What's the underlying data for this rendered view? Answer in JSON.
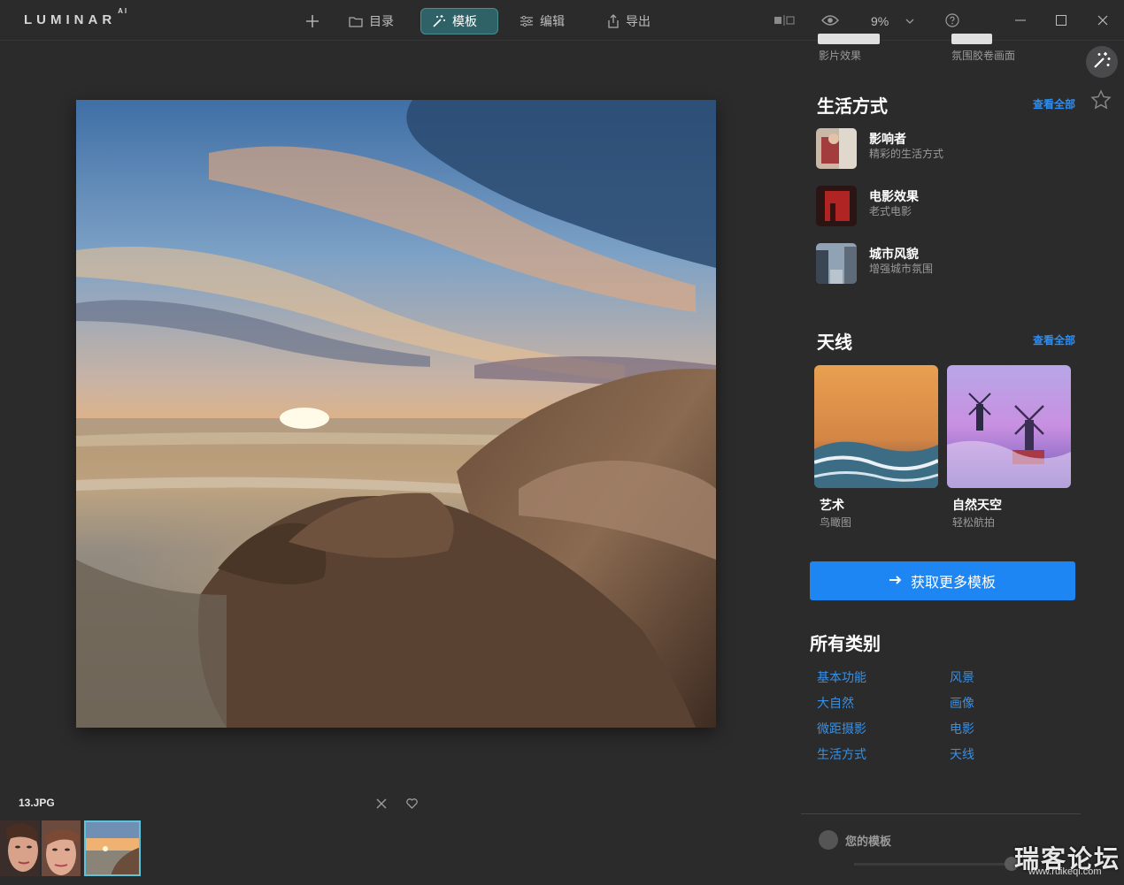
{
  "app": {
    "logo": "LUMINAR",
    "logo_suffix": "AI"
  },
  "toolbar": {
    "catalog_label": "目录",
    "templates_label": "模板",
    "edit_label": "编辑",
    "export_label": "导出",
    "zoom": "9%"
  },
  "filmstrip": {
    "filename": "13.JPG"
  },
  "panel": {
    "cutoff": {
      "left_sub": "影片效果",
      "right_sub": "氛围胶卷画面"
    },
    "lifestyle": {
      "title": "生活方式",
      "see_all": "查看全部",
      "items": [
        {
          "title": "影响者",
          "sub": "精彩的生活方式"
        },
        {
          "title": "电影效果",
          "sub": "老式电影"
        },
        {
          "title": "城市风貌",
          "sub": "增强城市氛围"
        }
      ]
    },
    "sky": {
      "title": "天线",
      "see_all": "查看全部",
      "cards": [
        {
          "title": "艺术",
          "sub": "鸟瞰图"
        },
        {
          "title": "自然天空",
          "sub": "轻松航拍"
        }
      ]
    },
    "cta_label": "获取更多模板",
    "categories": {
      "title": "所有类别",
      "items": [
        "基本功能",
        "风景",
        "大自然",
        "画像",
        "微距摄影",
        "电影",
        "生活方式",
        "天线"
      ]
    },
    "your_templates": "您的模板"
  },
  "watermark": {
    "text": "瑞客论坛",
    "sub": "www.ruikeqi.com"
  }
}
